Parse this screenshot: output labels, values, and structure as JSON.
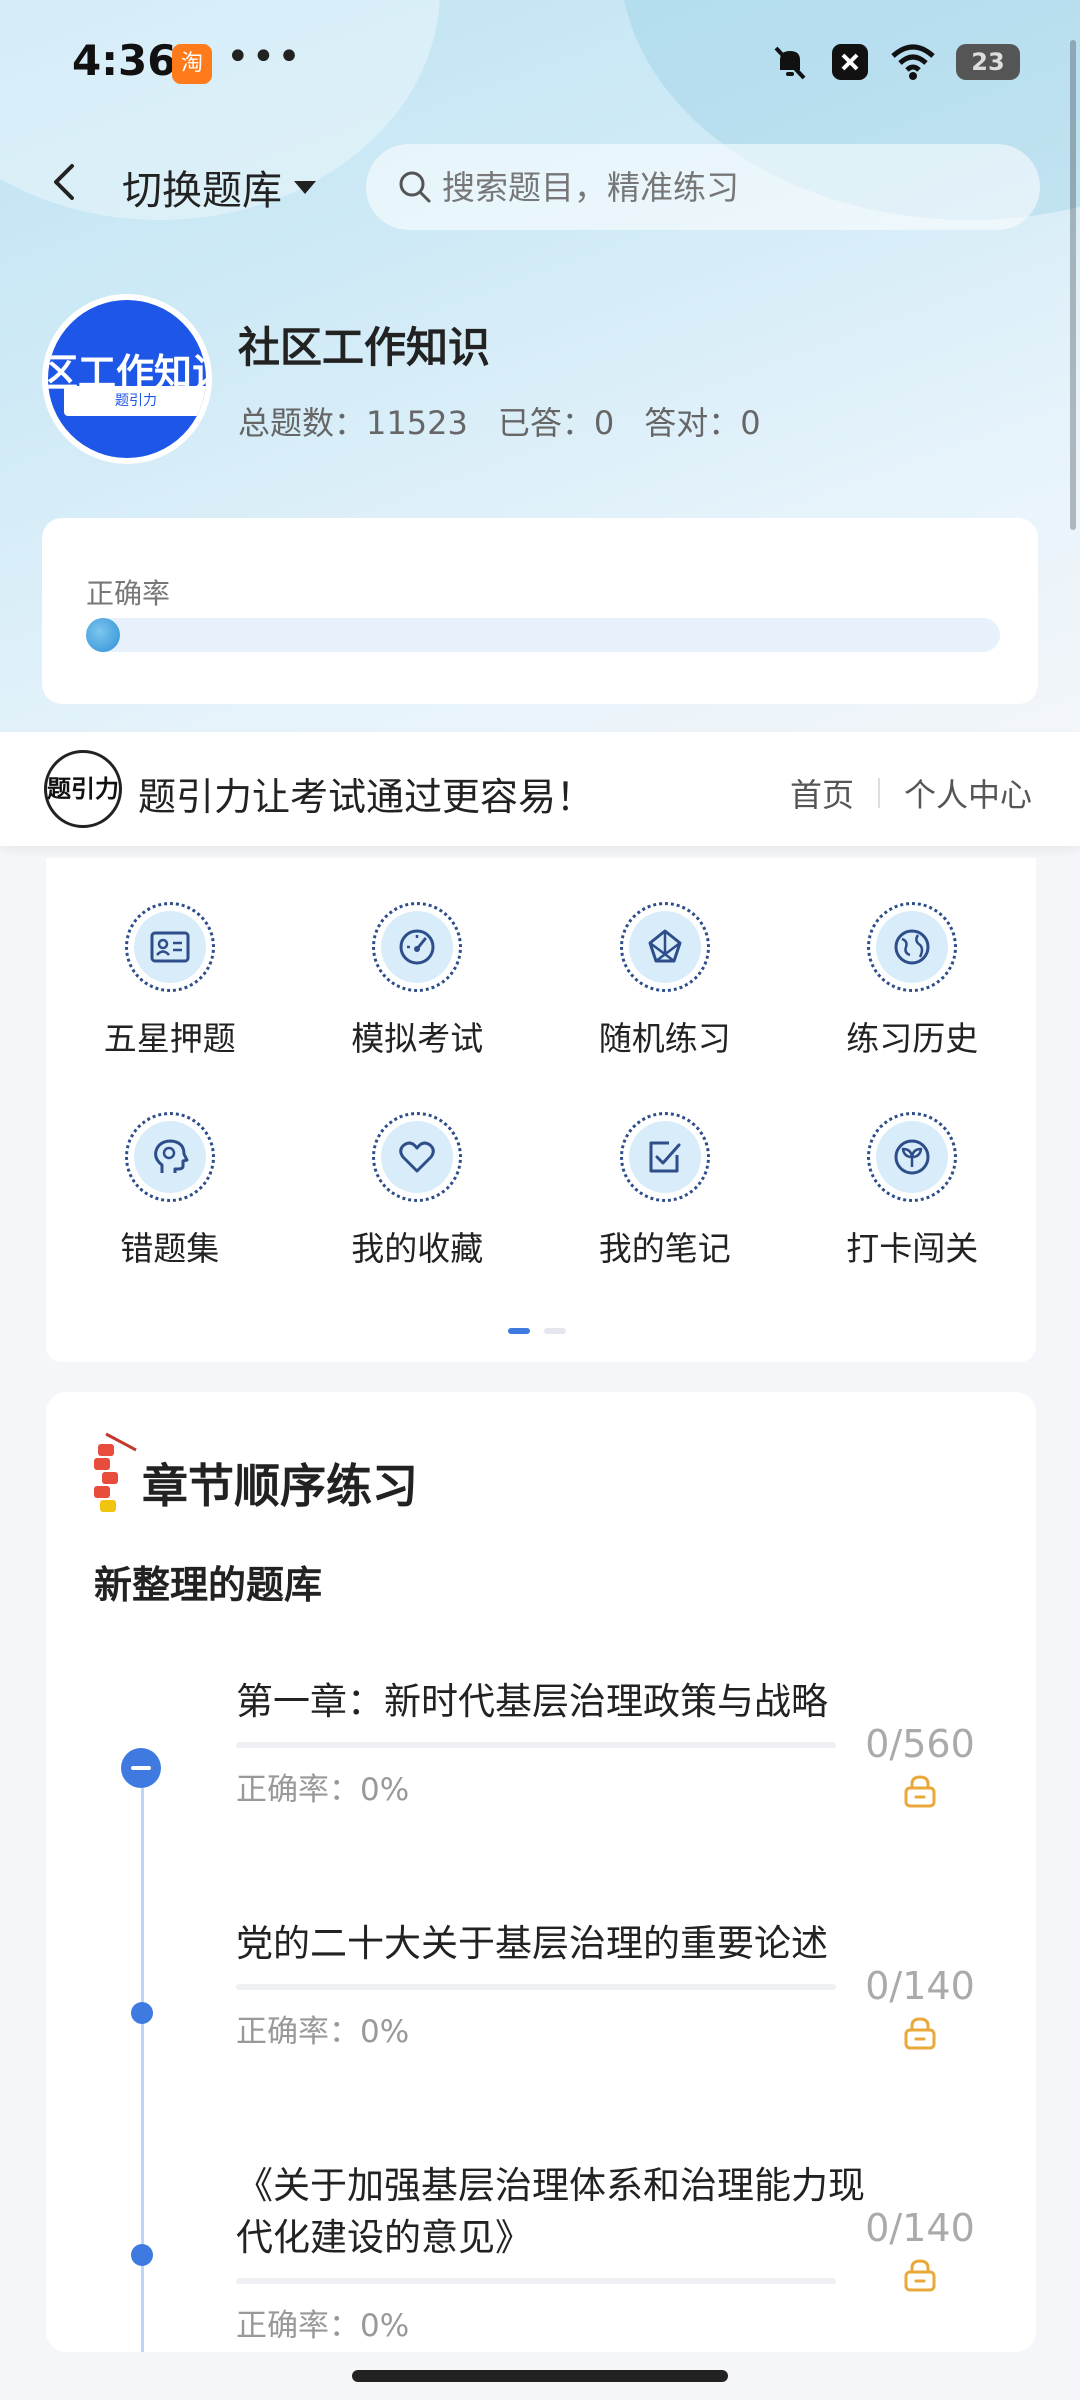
{
  "status_bar": {
    "time": "4:36",
    "taobao_glyph": "淘",
    "more": "•••",
    "battery": "23"
  },
  "nav": {
    "switch_label": "切换题库",
    "search_placeholder": "搜索题目，精准练习"
  },
  "book": {
    "cover_text": "区工作知识",
    "cover_sub": "题引力",
    "title": "社区工作知识",
    "total": "总题数：11523",
    "answered": "已答：0",
    "correct": "答对：0"
  },
  "accuracy": {
    "label": "正确率",
    "value": 0
  },
  "banner": {
    "logo_text": "题引力",
    "slogan": "题引力让考试通过更容易！",
    "nav_home": "首页",
    "nav_personal": "个人中心"
  },
  "features": [
    {
      "label": "五星押题",
      "icon": "id-card-icon"
    },
    {
      "label": "模拟考试",
      "icon": "speedometer-icon"
    },
    {
      "label": "随机练习",
      "icon": "shuffle-icon"
    },
    {
      "label": "练习历史",
      "icon": "globe-icon"
    },
    {
      "label": "错题集",
      "icon": "head-icon"
    },
    {
      "label": "我的收藏",
      "icon": "heart-icon"
    },
    {
      "label": "我的笔记",
      "icon": "note-check-icon"
    },
    {
      "label": "打卡闯关",
      "icon": "sprout-icon"
    }
  ],
  "chapters_section": {
    "title": "章节顺序练习",
    "subtitle": "新整理的题库",
    "chapters": [
      {
        "name": "第一章：新时代基层治理政策与战略",
        "count": "0/560",
        "rate": "正确率：0%"
      },
      {
        "name": "党的二十大关于基层治理的重要论述",
        "count": "0/140",
        "rate": "正确率：0%"
      },
      {
        "name": "《关于加强基层治理体系和治理能力现代化建设的意见》",
        "count": "0/140",
        "rate": "正确率：0%"
      }
    ]
  },
  "colors": {
    "accent": "#3f7ae0",
    "cover_blue": "#1e56e8",
    "lock": "#e8a93a"
  }
}
